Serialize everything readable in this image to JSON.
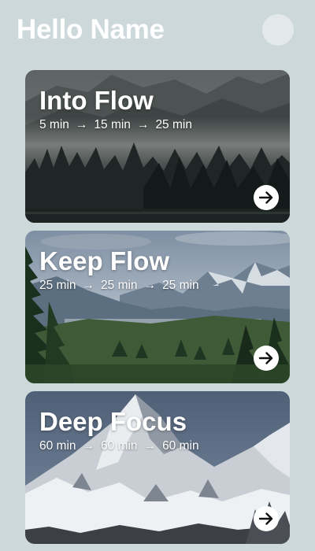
{
  "header": {
    "greeting": "Hello Name",
    "avatar_icon": "user-avatar-circle"
  },
  "sessions": [
    {
      "title": "Into Flow",
      "schedule": [
        "5 min",
        "15 min",
        "25 min"
      ],
      "arrow_glyph": "→",
      "scene": "foggy-forest-mountains",
      "button_icon": "arrow-right-circle-icon"
    },
    {
      "title": "Keep Flow",
      "schedule": [
        "25 min",
        "25 min",
        "25 min"
      ],
      "arrow_glyph": "→",
      "scene": "pine-valley-mountains",
      "button_icon": "arrow-right-circle-icon"
    },
    {
      "title": "Deep Focus",
      "schedule": [
        "60 min",
        "60 min",
        "60 min"
      ],
      "arrow_glyph": "→",
      "scene": "snowy-alpine-peak",
      "button_icon": "arrow-right-circle-icon"
    }
  ],
  "colors": {
    "background": "#cdd8da",
    "text": "#ffffff",
    "button": "#ffffff",
    "button_arrow": "#111111"
  }
}
